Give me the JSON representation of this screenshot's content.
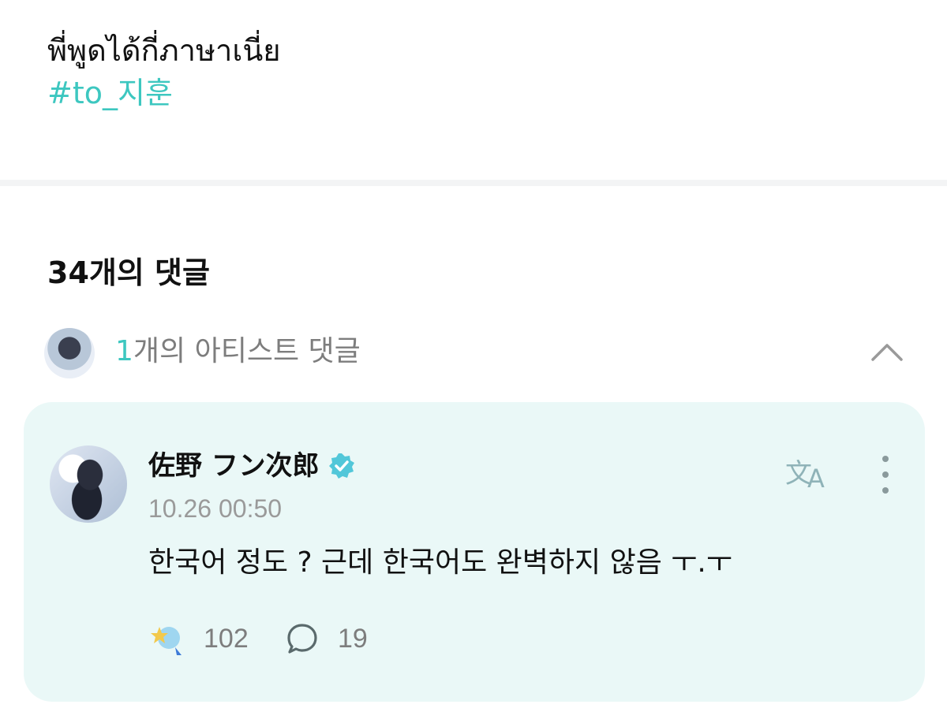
{
  "post": {
    "text": "พี่พูดได้กี่ภาษาเนี่ย",
    "hashtag": "#to_지훈"
  },
  "comments": {
    "count_label": "34개의 댓글",
    "artist_section": {
      "count": "1",
      "label": "개의 아티스트 댓글"
    }
  },
  "comment": {
    "author": "佐野 フン次郎",
    "verified": true,
    "timestamp": "10.26 00:50",
    "body": "한국어 정도 ? 근데 한국어도 완벽하지 않음 ㅜ.ㅜ",
    "likes": "102",
    "replies": "19"
  },
  "colors": {
    "accent": "#3dc7c0",
    "card_bg": "#eaf8f7",
    "muted_text": "#7d7d7d"
  },
  "icons": [
    "chevron-up-icon",
    "verified-icon",
    "translate-icon",
    "more-vertical-icon",
    "reaction-icon",
    "reply-icon"
  ]
}
